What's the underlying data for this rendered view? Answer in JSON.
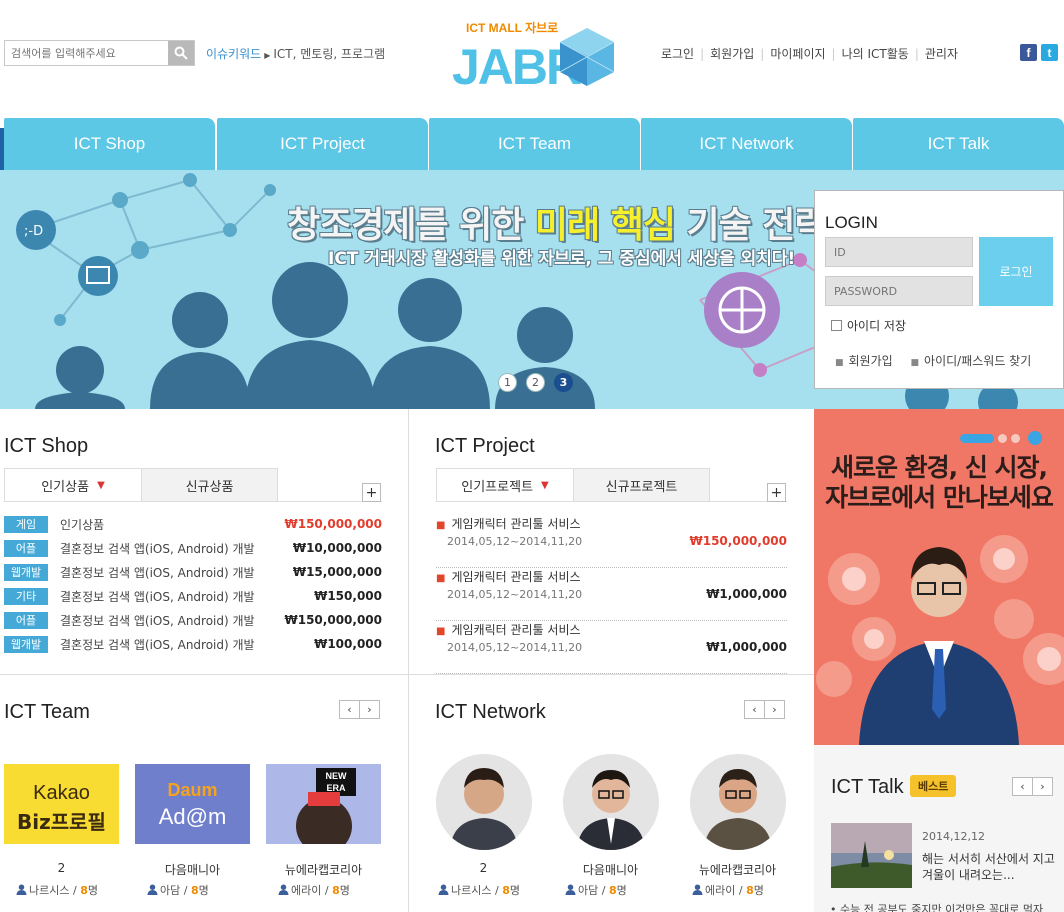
{
  "header": {
    "search_placeholder": "검색어를 입력해주세요",
    "issue_label": "이슈키워드",
    "issue_keywords": "ICT, 멘토링, 프로그램",
    "logo_top": "ICT MALL 자브로",
    "logo_main": "JABR",
    "links": [
      "로그인",
      "회원가입",
      "마이페이지",
      "나의 ICT활동",
      "관리자"
    ],
    "facebook": "f",
    "twitter": "t"
  },
  "nav": [
    "ICT Shop",
    "ICT Project",
    "ICT Team",
    "ICT Network",
    "ICT Talk"
  ],
  "banner": {
    "title_a": "창조경제를 위한 ",
    "title_hl": "미래 핵심",
    "title_b": " 기술 전략",
    "subtitle": "ICT 거래시장 활성화를 위한 자브로, 그 중심에서 세상을 외치다!",
    "dots": [
      "1",
      "2",
      "3"
    ],
    "active_dot": 3
  },
  "login": {
    "title": "LOGIN",
    "id_placeholder": "ID",
    "pw_placeholder": "PASSWORD",
    "button": "로그인",
    "save_id": "아이디 저장",
    "join": "회원가입",
    "find": "아이디/패스워드 찾기"
  },
  "shop": {
    "title": "ICT Shop",
    "tabs": [
      "인기상품",
      "신규상품"
    ],
    "plus": "+",
    "items": [
      {
        "badge": "게임",
        "name": "인기상품",
        "price": "₩150,000,000",
        "red": true
      },
      {
        "badge": "어플",
        "name": "결혼정보 검색 앱(iOS, Android) 개발",
        "price": "₩10,000,000",
        "red": false
      },
      {
        "badge": "웹개발",
        "name": "결혼정보 검색 앱(iOS, Android) 개발",
        "price": "₩15,000,000",
        "red": false
      },
      {
        "badge": "기타",
        "name": "결혼정보 검색 앱(iOS, Android) 개발",
        "price": "₩150,000",
        "red": false
      },
      {
        "badge": "어플",
        "name": "결혼정보 검색 앱(iOS, Android) 개발",
        "price": "₩150,000,000",
        "red": false
      },
      {
        "badge": "웹개발",
        "name": "결혼정보 검색 앱(iOS, Android) 개발",
        "price": "₩100,000",
        "red": false
      }
    ]
  },
  "project": {
    "title": "ICT Project",
    "tabs": [
      "인기프로젝트",
      "신규프로젝트"
    ],
    "plus": "+",
    "items": [
      {
        "title": "게임캐릭터 관리툴 서비스",
        "date": "2014,05,12~2014,11,20",
        "price": "₩150,000,000",
        "red": true
      },
      {
        "title": "게임캐릭터 관리툴 서비스",
        "date": "2014,05,12~2014,11,20",
        "price": "₩1,000,000",
        "red": false
      },
      {
        "title": "게임캐릭터 관리툴 서비스",
        "date": "2014,05,12~2014,11,20",
        "price": "₩1,000,000",
        "red": false
      }
    ]
  },
  "team": {
    "title": "ICT Team",
    "prev": "‹",
    "next": "›",
    "cards": [
      {
        "img_a": "Kakao",
        "img_b": "Biz프로필",
        "name": "2",
        "user": "나르시스",
        "count": "8",
        "unit": "명"
      },
      {
        "img_a": "Daum",
        "img_b": "Ad@m",
        "name": "다음매니아",
        "user": "아담",
        "count": "8",
        "unit": "명"
      },
      {
        "img_a": "NEW",
        "img_b": "ERA",
        "name": "뉴에라캡코리아",
        "user": "에라이",
        "count": "8",
        "unit": "명"
      }
    ]
  },
  "network": {
    "title": "ICT Network",
    "prev": "‹",
    "next": "›",
    "cards": [
      {
        "name": "2",
        "user": "나르시스",
        "count": "8",
        "unit": "명"
      },
      {
        "name": "다음매니아",
        "user": "아담",
        "count": "8",
        "unit": "명"
      },
      {
        "name": "뉴에라캡코리아",
        "user": "에라이",
        "count": "8",
        "unit": "명"
      }
    ]
  },
  "promo": {
    "line1": "새로운 환경, 신 시장,",
    "line2": "자브로에서 만나보세요"
  },
  "talk": {
    "title": "ICT Talk",
    "badge": "베스트",
    "prev": "‹",
    "next": "›",
    "date": "2014,12,12",
    "text": "해는 서서히 서산에서 지고 겨울이 내려오는...",
    "more": "수능 전 공부도 중지만 이것만은 꼭대로 먹자"
  },
  "colors": {
    "accent": "#5cc8e6",
    "badge": "#45a9d8",
    "price_red": "#e23c2d",
    "promo_bg": "#f07765"
  }
}
